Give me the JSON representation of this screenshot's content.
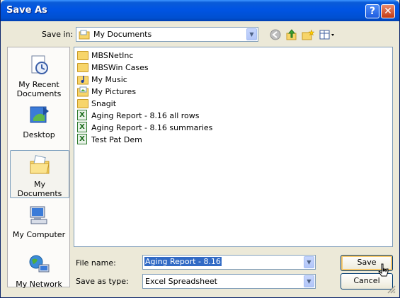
{
  "window": {
    "title": "Save As",
    "help_glyph": "?",
    "close_glyph": "✕"
  },
  "toolbar": {
    "save_in_label": "Save in:",
    "save_in_value": "My Documents",
    "icons": [
      "back-icon",
      "up-folder-icon",
      "new-folder-icon",
      "views-menu-icon"
    ]
  },
  "places": [
    {
      "label": "My Recent Documents",
      "icon": "recent-documents-icon"
    },
    {
      "label": "Desktop",
      "icon": "desktop-icon"
    },
    {
      "label": "My Documents",
      "icon": "my-documents-icon",
      "selected": true
    },
    {
      "label": "My Computer",
      "icon": "my-computer-icon"
    },
    {
      "label": "My Network",
      "icon": "my-network-icon"
    }
  ],
  "files": [
    {
      "name": "MBSNetInc",
      "type": "folder"
    },
    {
      "name": "MBSWin Cases",
      "type": "folder"
    },
    {
      "name": "My Music",
      "type": "music-folder"
    },
    {
      "name": "My Pictures",
      "type": "pictures-folder"
    },
    {
      "name": "Snagit",
      "type": "folder"
    },
    {
      "name": "Aging Report - 8.16 all rows",
      "type": "excel"
    },
    {
      "name": "Aging Report - 8.16 summaries",
      "type": "excel"
    },
    {
      "name": "Test Pat Dem",
      "type": "excel"
    }
  ],
  "form": {
    "file_name_label": "File name:",
    "file_name_value": "Aging Report - 8.16",
    "save_as_type_label": "Save as type:",
    "save_as_type_value": "Excel Spreadsheet"
  },
  "buttons": {
    "save": "Save",
    "cancel": "Cancel"
  },
  "colors": {
    "titlebar": "#0054e3",
    "dialog_bg": "#ece9d8",
    "selection": "#316ac5"
  }
}
